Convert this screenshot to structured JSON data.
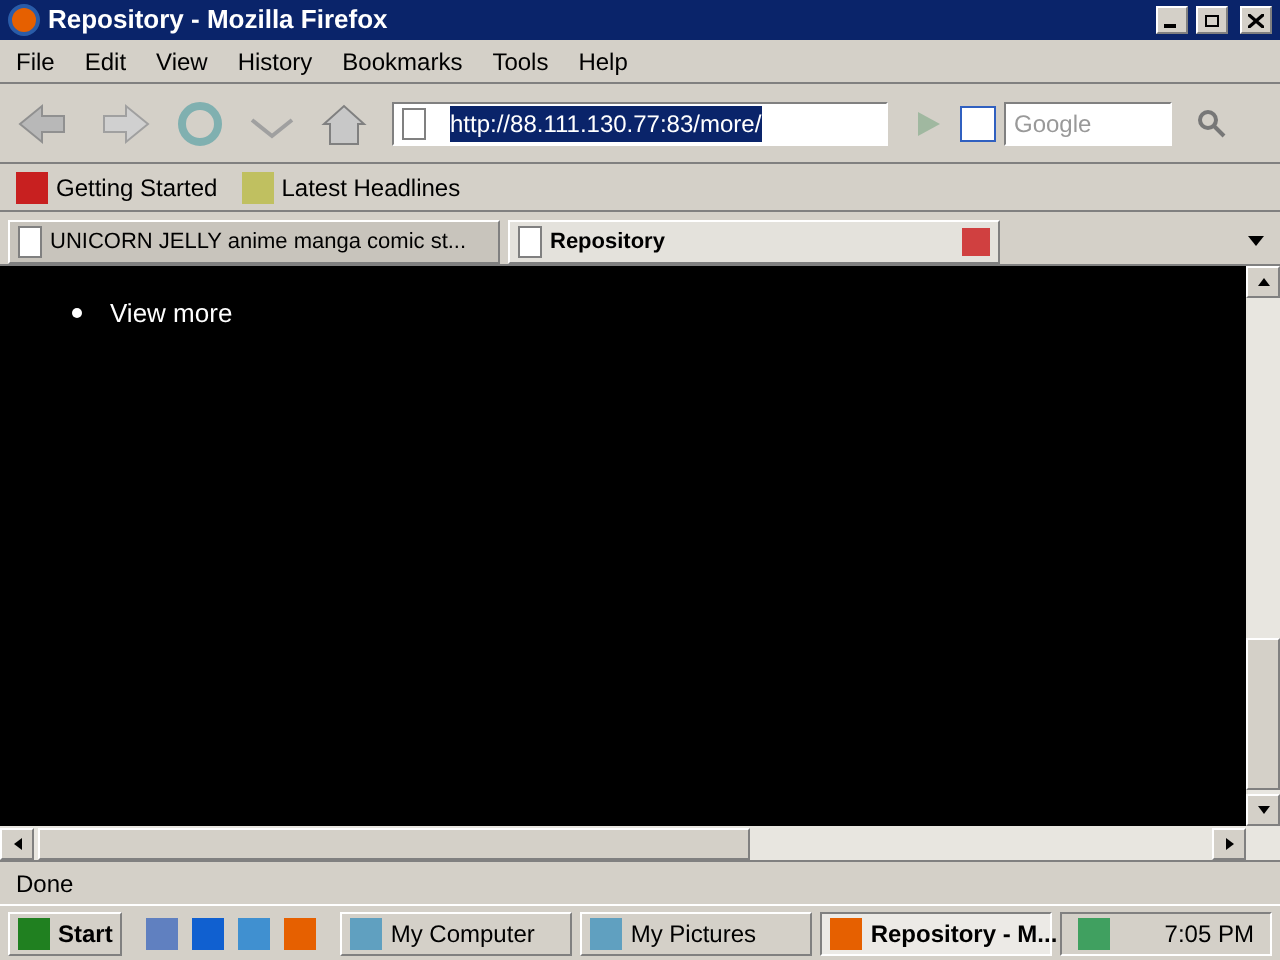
{
  "window": {
    "title": "Repository - Mozilla Firefox"
  },
  "menu": [
    "File",
    "Edit",
    "View",
    "History",
    "Bookmarks",
    "Tools",
    "Help"
  ],
  "address": {
    "value": "http://88.111.130.77:83/more/"
  },
  "search": {
    "placeholder": "Google"
  },
  "bookmarks": [
    "Getting Started",
    "Latest Headlines"
  ],
  "tabs": [
    {
      "label": "UNICORN JELLY anime manga comic st...",
      "selected": false
    },
    {
      "label": "Repository",
      "selected": true
    }
  ],
  "content": {
    "items": [
      "View more"
    ]
  },
  "status_bar": "Done",
  "taskbar": {
    "start": "Start",
    "tasks": [
      {
        "label": "My Computer",
        "selected": false
      },
      {
        "label": "My Pictures",
        "selected": false
      },
      {
        "label": "Repository - M...",
        "selected": true
      }
    ],
    "clock": "7:05 PM"
  }
}
